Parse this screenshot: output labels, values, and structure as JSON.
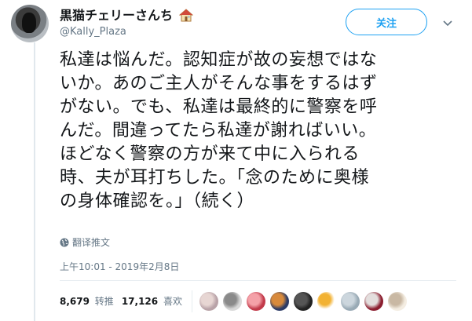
{
  "user": {
    "display_name": "黒猫チェリーさんち",
    "handle": "@Kally_Plaza"
  },
  "follow_label": "关注",
  "tweet_lines": [
    "私達は悩んだ。認知症が故の妄想ではな",
    "いか。あのご主人がそんな事をするはず",
    "がない。でも、私達は最終的に警察を呼",
    "んだ。間違ってたら私達が謝ればいい。",
    "ほどなく警察の方が来て中に入られる",
    "時、夫が耳打ちした。「念のために奥様",
    "の身体確認を。」（続く）"
  ],
  "translate_label": "翻译推文",
  "timestamp": "上午10:01 - 2019年2月8日",
  "stats": {
    "retweets_count": "8,679",
    "retweets_label": "转推",
    "likes_count": "17,126",
    "likes_label": "喜欢"
  },
  "liker_avatars": [
    {
      "color_a": "#b9a3a8",
      "color_b": "#e7d6d3"
    },
    {
      "color_a": "#d9d9d9",
      "color_b": "#8a8a8a"
    },
    {
      "color_a": "#c23a4a",
      "color_b": "#f4a1a8"
    },
    {
      "color_a": "#2c3b66",
      "color_b": "#d88a3c"
    },
    {
      "color_a": "#222222",
      "color_b": "#555555"
    },
    {
      "color_a": "#ffffff",
      "color_b": "#f2b233"
    },
    {
      "color_a": "#99aab5",
      "color_b": "#ccd6dd"
    },
    {
      "color_a": "#8b1e2f",
      "color_b": "#e3dedd"
    },
    {
      "color_a": "#f4ede2",
      "color_b": "#c9b8a3"
    }
  ],
  "colors": {
    "accent": "#1da1f2",
    "secondary_text": "#657786"
  }
}
